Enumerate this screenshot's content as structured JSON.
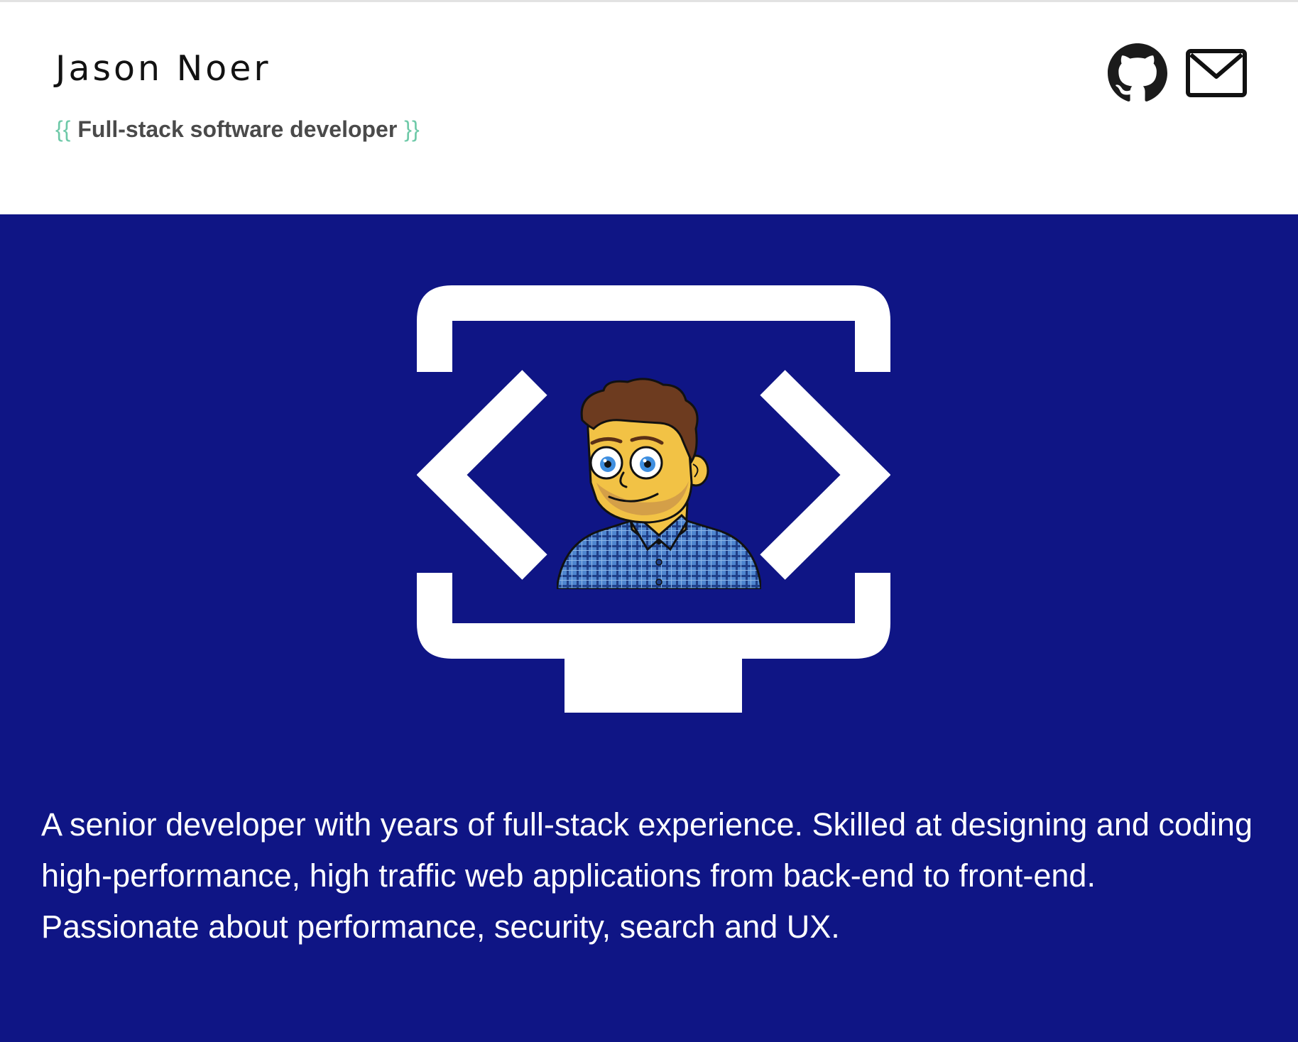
{
  "header": {
    "name": "Jason Noer",
    "tagline": {
      "open_brace": "{{",
      "text": "Full-stack software developer",
      "close_brace": "}}"
    },
    "links": [
      {
        "icon": "github-icon",
        "label": "GitHub"
      },
      {
        "icon": "mail-icon",
        "label": "Email"
      }
    ]
  },
  "hero": {
    "logo": "monitor-code-icon",
    "avatar": "cartoon-avatar",
    "bio": "A senior developer with years of full-stack experience. Skilled at designing and coding high-performance, high traffic web applications from back-end to front-end. Passionate about performance, security, search and UX."
  },
  "colors": {
    "hero_background": "#0f1585",
    "brace_accent": "#6ec9a8",
    "name_text": "#121212",
    "tagline_text": "#4a4a4a",
    "bio_text": "#ffffff"
  }
}
